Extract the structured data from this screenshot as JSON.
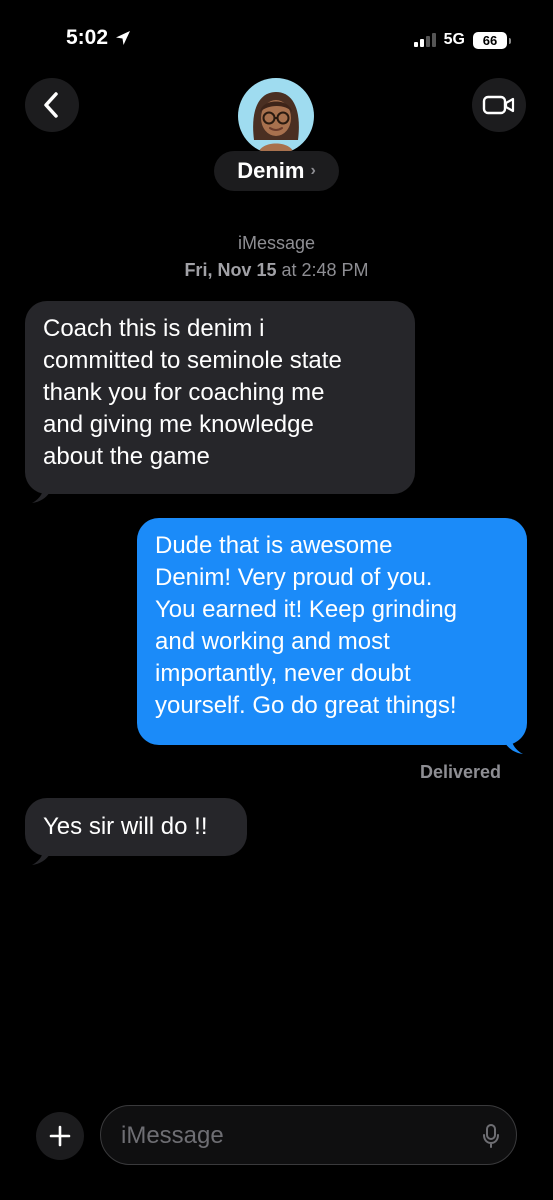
{
  "status_bar": {
    "time": "5:02",
    "network": "5G",
    "battery": "66"
  },
  "header": {
    "contact_name": "Denim",
    "chevron": "›"
  },
  "thread": {
    "service": "iMessage",
    "timestamp_day": "Fri, Nov 15",
    "timestamp_at": "at",
    "timestamp_time": "2:48 PM"
  },
  "messages": [
    {
      "direction": "incoming",
      "lines": [
        "Coach this is denim i",
        "committed to seminole state",
        "thank you for coaching me",
        "and giving me knowledge",
        "about the game"
      ]
    },
    {
      "direction": "outgoing",
      "lines": [
        "Dude that is awesome",
        "Denim!  Very proud of you.",
        "You earned it! Keep grinding",
        "and working and most",
        "importantly, never doubt",
        "yourself. Go do great things!"
      ]
    },
    {
      "direction": "incoming",
      "lines": [
        "Yes sir will do !!"
      ]
    }
  ],
  "delivery_status": "Delivered",
  "composer": {
    "placeholder": "iMessage"
  },
  "icons": {
    "location": "location-arrow-icon",
    "signal": "cellular-signal-icon",
    "battery": "battery-icon",
    "back": "chevron-left-icon",
    "video": "video-camera-icon",
    "avatar": "memoji-avatar",
    "plus": "plus-icon",
    "mic": "microphone-icon"
  },
  "colors": {
    "outgoing_bubble": "#1b8bf9",
    "incoming_bubble": "#26262a",
    "background": "#000000"
  }
}
